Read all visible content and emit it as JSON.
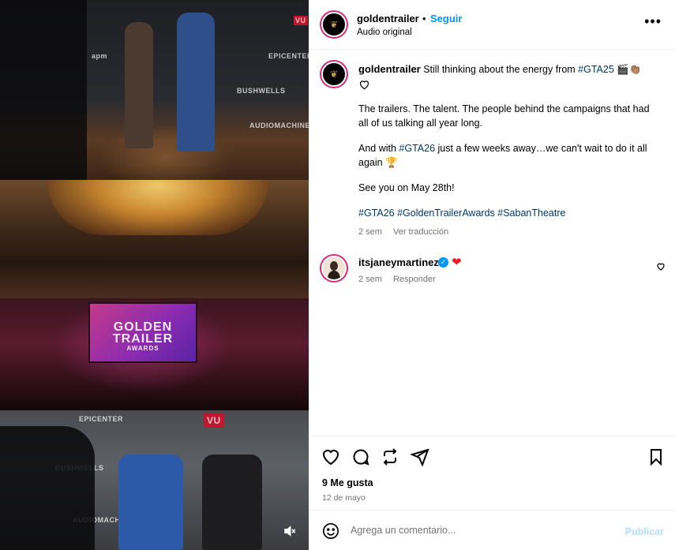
{
  "media": {
    "backdrop_logos": [
      "EPICENTER",
      "VU",
      "BUSHWELLS",
      "apm",
      "AUDIOMACHINE"
    ],
    "screen_text": [
      "GOLDEN",
      "TRAILER",
      "AWARDS"
    ],
    "mute_icon": "speaker-muted-icon"
  },
  "header": {
    "username": "goldentrailer",
    "separator": "•",
    "follow_label": "Seguir",
    "audio_label": "Audio original",
    "more_icon": "more-options-icon"
  },
  "caption": {
    "username": "goldentrailer",
    "line1_text": " Still thinking about the energy from ",
    "line1_tag": "#GTA25",
    "line1_emoji": " 🎬👏🏽",
    "para2": "The trailers. The talent. The people behind the campaigns that had all of us talking all year long.",
    "para3_pre": "And with ",
    "para3_tag": "#GTA26",
    "para3_post": " just a few weeks away…we can't wait to do it all again 🏆",
    "para4": "See you on May 28th!",
    "hashtags": [
      "#GTA26",
      "#GoldenTrailerAwards",
      "#SabanTheatre"
    ],
    "time": "2 sem",
    "translate_label": "Ver traducción"
  },
  "comment": {
    "username": "itsjaneymartinez",
    "verified": "✓",
    "text": "❤",
    "time": "2 sem",
    "reply_label": "Responder"
  },
  "actions": {
    "like_icon": "heart-icon",
    "comment_icon": "comment-icon",
    "share_icon": "repost-icon",
    "send_icon": "send-icon",
    "save_icon": "bookmark-icon",
    "likes": "9 Me gusta",
    "date": "12 de mayo"
  },
  "add_comment": {
    "placeholder": "Agrega un comentario...",
    "publish_label": "Publicar",
    "emoji_icon": "emoji-icon"
  },
  "colors": {
    "link_blue": "#0095f6",
    "hashtag_blue": "#00376b",
    "muted_text": "#737373",
    "publish_disabled": "#b2dffc",
    "heart_red": "#ed1c24"
  }
}
